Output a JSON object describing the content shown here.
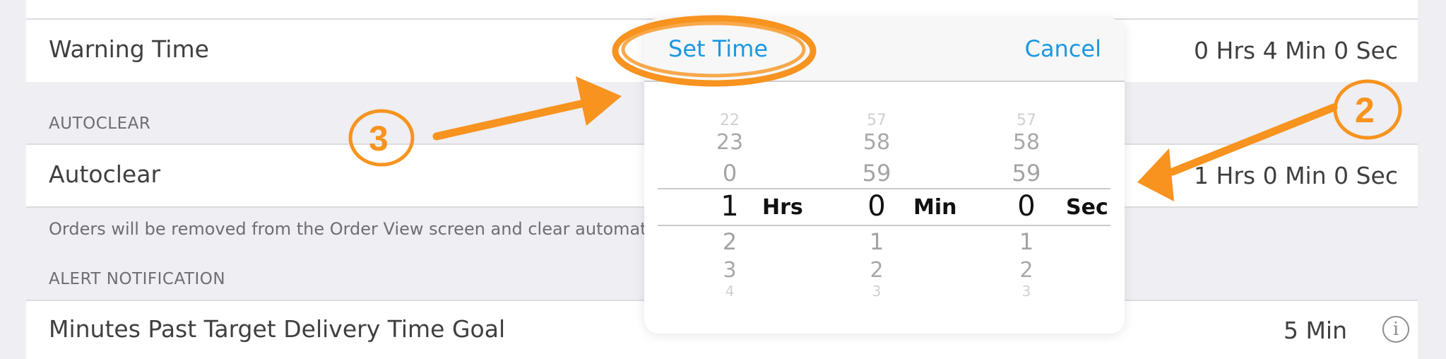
{
  "rows": {
    "warning_time": {
      "label": "Warning Time",
      "value": "0 Hrs 4 Min 0 Sec"
    },
    "autoclear": {
      "label": "Autoclear",
      "value": "1 Hrs 0 Min 0 Sec"
    },
    "minutes_past": {
      "label": "Minutes Past Target Delivery Time Goal",
      "value": "5 Min"
    }
  },
  "sections": {
    "autoclear": "AUTOCLEAR",
    "alert": "ALERT NOTIFICATION"
  },
  "autoclear_note": "Orders will be removed from the Order View screen and clear automat",
  "picker": {
    "set_time": "Set Time",
    "cancel": "Cancel",
    "columns": [
      {
        "unit": "Hrs",
        "above": [
          "22",
          "23",
          "0"
        ],
        "selected": "1",
        "below": [
          "2",
          "3",
          "4"
        ]
      },
      {
        "unit": "Min",
        "above": [
          "57",
          "58",
          "59"
        ],
        "selected": "0",
        "below": [
          "1",
          "2",
          "3"
        ]
      },
      {
        "unit": "Sec",
        "above": [
          "57",
          "58",
          "59"
        ],
        "selected": "0",
        "below": [
          "1",
          "2",
          "3"
        ]
      }
    ]
  },
  "annotations": {
    "callout_3": "3",
    "callout_2": "2",
    "color": "#f7931e"
  },
  "info_glyph": "i"
}
